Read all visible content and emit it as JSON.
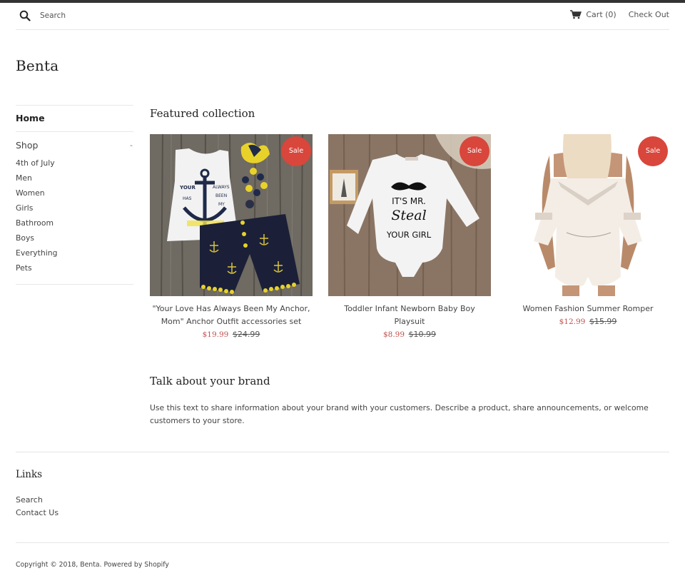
{
  "header": {
    "search_placeholder": "Search",
    "cart_label": "Cart (0)",
    "checkout_label": "Check Out"
  },
  "store": {
    "logo": "Benta"
  },
  "sidebar": {
    "home_label": "Home",
    "shop_label": "Shop",
    "shop_toggle": "-",
    "shop_items": [
      {
        "label": "4th of July"
      },
      {
        "label": "Men"
      },
      {
        "label": "Women"
      },
      {
        "label": "Girls"
      },
      {
        "label": "Bathroom"
      },
      {
        "label": "Boys"
      },
      {
        "label": "Everything"
      },
      {
        "label": "Pets"
      }
    ]
  },
  "featured": {
    "title": "Featured collection",
    "products": [
      {
        "title": "\"Your Love Has Always Been My Anchor, Mom\" Anchor Outfit accessories set",
        "badge": "Sale",
        "sale_price": "$19.99",
        "original_price": "$24.99",
        "image_desc": "white anchor tank top with navy anchor-print shorts and yellow pom-poms"
      },
      {
        "title": "Toddler Infant Newborn Baby Boy Playsuit",
        "badge": "Sale",
        "sale_price": "$8.99",
        "original_price": "$10.99",
        "image_desc": "white onesie printed IT'S MR. Steal YOUR GIRL with mustache"
      },
      {
        "title": "Women Fashion Summer Romper",
        "badge": "Sale",
        "sale_price": "$12.99",
        "original_price": "$15.99",
        "image_desc": "white off-shoulder lace romper"
      }
    ],
    "onesie_text": [
      "IT'S MR.",
      "Steal",
      "YOUR GIRL"
    ]
  },
  "brand": {
    "title": "Talk about your brand",
    "text": "Use this text to share information about your brand with your customers. Describe a product, share announcements, or welcome customers to your store."
  },
  "footer": {
    "links_title": "Links",
    "links": [
      {
        "label": "Search"
      },
      {
        "label": "Contact Us"
      }
    ],
    "copyright": "Copyright © 2018, Benta. Powered by Shopify"
  },
  "colors": {
    "sale_badge": "#d9463b",
    "sale_price": "#c0504d",
    "top_strip": "#333333"
  }
}
